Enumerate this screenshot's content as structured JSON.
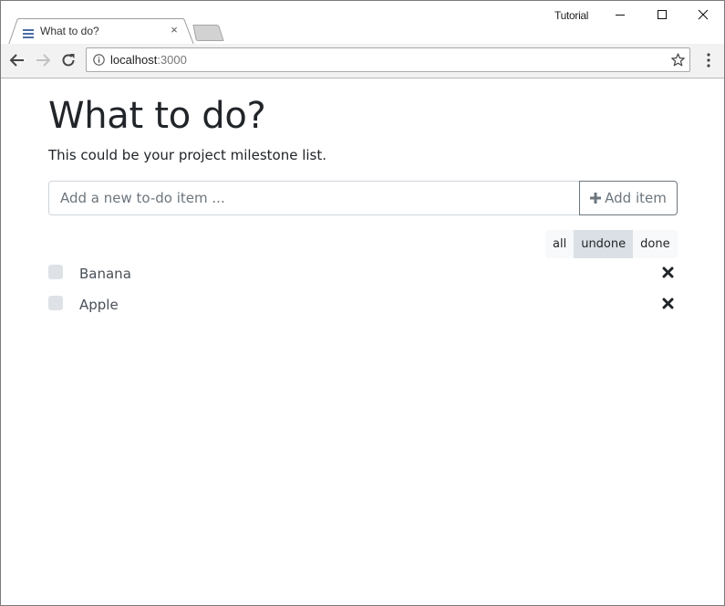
{
  "browser": {
    "tab": {
      "title": "What to do?",
      "close_glyph": "×"
    },
    "profile_name": "Tutorial",
    "address_bar": {
      "host": "localhost",
      "port": ":3000"
    },
    "icons": {
      "tab_menu": "hamburger-icon",
      "back": "arrow-left-icon",
      "forward": "arrow-right-icon",
      "reload": "reload-icon",
      "site_info": "info-icon",
      "bookmark": "star-icon",
      "menu": "kebab-menu-icon",
      "minimize": "minimize-icon",
      "maximize": "maximize-icon",
      "close": "close-icon"
    }
  },
  "page": {
    "title": "What to do?",
    "subtitle": "This could be your project milestone list.",
    "new_item": {
      "placeholder": "Add a new to-do item ...",
      "value": "",
      "button_label": "Add item"
    },
    "filters": [
      {
        "label": "all",
        "active": false
      },
      {
        "label": "undone",
        "active": true
      },
      {
        "label": "done",
        "active": false
      }
    ],
    "items": [
      {
        "text": "Banana",
        "done": false
      },
      {
        "text": "Apple",
        "done": false
      }
    ]
  },
  "colors": {
    "heading": "#212529",
    "muted": "#6c757d",
    "active_filter": "#dae0e5",
    "filter_bg": "#f8f9fa",
    "checkbox": "#dee2e6",
    "tab_icon": "#4a6fa5"
  }
}
